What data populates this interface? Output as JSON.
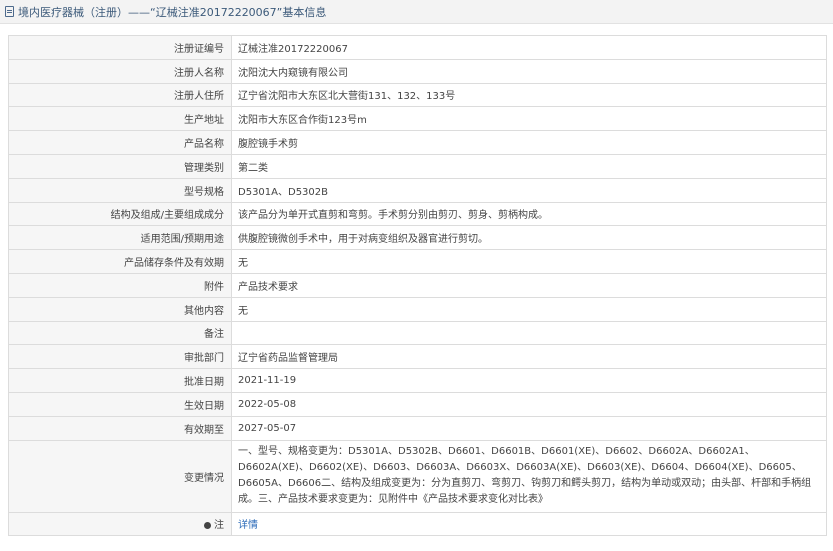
{
  "header": {
    "title": "境内医疗器械（注册）——“辽械注准20172220067”基本信息"
  },
  "rows": [
    {
      "label": "注册证编号",
      "value": "辽械注准20172220067"
    },
    {
      "label": "注册人名称",
      "value": "沈阳沈大内窥镜有限公司"
    },
    {
      "label": "注册人住所",
      "value": "辽宁省沈阳市大东区北大营街131、132、133号"
    },
    {
      "label": "生产地址",
      "value": "沈阳市大东区合作街123号m"
    },
    {
      "label": "产品名称",
      "value": "腹腔镜手术剪"
    },
    {
      "label": "管理类别",
      "value": "第二类"
    },
    {
      "label": "型号规格",
      "value": "D5301A、D5302B"
    },
    {
      "label": "结构及组成/主要组成成分",
      "value": "该产品分为单开式直剪和弯剪。手术剪分别由剪刃、剪身、剪柄构成。"
    },
    {
      "label": "适用范围/预期用途",
      "value": "供腹腔镜微创手术中，用于对病变组织及器官进行剪切。"
    },
    {
      "label": "产品储存条件及有效期",
      "value": "无"
    },
    {
      "label": "附件",
      "value": "产品技术要求"
    },
    {
      "label": "其他内容",
      "value": "无"
    },
    {
      "label": "备注",
      "value": ""
    },
    {
      "label": "审批部门",
      "value": "辽宁省药品监督管理局"
    },
    {
      "label": "批准日期",
      "value": "2021-11-19"
    },
    {
      "label": "生效日期",
      "value": "2022-05-08"
    },
    {
      "label": "有效期至",
      "value": "2027-05-07"
    },
    {
      "label": "变更情况",
      "value": "一、型号、规格变更为：D5301A、D5302B、D6601、D6601B、D6601(XE)、D6602、D6602A、D6602A1、D6602A(XE)、D6602(XE)、D6603、D6603A、D6603X、D6603A(XE)、D6603(XE)、D6604、D6604(XE)、D6605、D6605A、D6606二、结构及组成变更为：分为直剪刀、弯剪刀、钩剪刀和鳄头剪刀，结构为单动或双动；由头部、杆部和手柄组成。三、产品技术要求变更为：见附件中《产品技术要求变化对比表》"
    }
  ],
  "note_row": {
    "label": "注",
    "link": "详情",
    "icon": "pin-icon"
  }
}
